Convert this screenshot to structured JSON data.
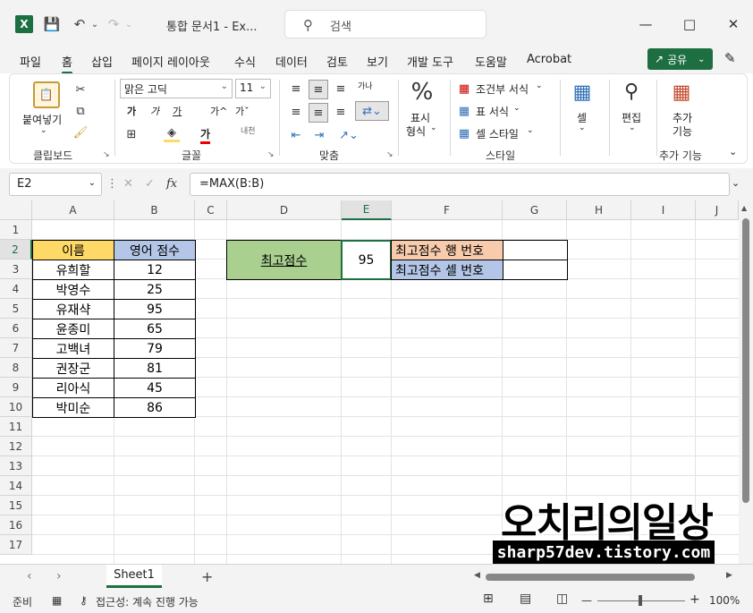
{
  "titlebar": {
    "app_icon": "X",
    "doc_title": "통합 문서1  -  Ex...",
    "search_placeholder": "검색"
  },
  "menu": {
    "tabs": [
      "파일",
      "홈",
      "삽입",
      "페이지 레이아웃",
      "수식",
      "데이터",
      "검토",
      "보기",
      "개발 도구",
      "도움말",
      "Acrobat"
    ],
    "active_tab": "홈",
    "share_label": "공유"
  },
  "ribbon": {
    "clipboard": {
      "paste_label": "붙여넣기",
      "group_label": "클립보드"
    },
    "font": {
      "font_name": "맑은 고딕",
      "font_size": "11",
      "bold_glyph": "가",
      "italic_glyph": "가",
      "underline_glyph": "가",
      "grow_glyph": "가^",
      "shrink_glyph": "가ˇ",
      "phonetic_glyph": "내천",
      "font_color_glyph": "가",
      "group_label": "글꼴"
    },
    "alignment": {
      "wrap_glyph": "가나",
      "group_label": "맞춤"
    },
    "number": {
      "label_line1": "표시",
      "label_line2": "형식",
      "group_label": ""
    },
    "styles": {
      "conditional": "조건부 서식",
      "table_format": "표 서식",
      "cell_style": "셀 스타일",
      "group_label": "스타일"
    },
    "cells": {
      "label": "셀"
    },
    "editing": {
      "label": "편집"
    },
    "addins": {
      "label_line1": "추가",
      "label_line2": "기능",
      "group_label": "추가 기능"
    }
  },
  "formula_bar": {
    "name_box": "E2",
    "fx": "fx",
    "formula": "=MAX(B:B)"
  },
  "sheet": {
    "columns": [
      "A",
      "B",
      "C",
      "D",
      "E",
      "F",
      "G",
      "H",
      "I",
      "J"
    ],
    "selected_column": "E",
    "rows": [
      "1",
      "2",
      "3",
      "4",
      "5",
      "6",
      "7",
      "8",
      "9",
      "10",
      "11",
      "12",
      "13",
      "14",
      "15",
      "16",
      "17"
    ],
    "selected_row": "2",
    "table_headers": [
      "이름",
      "영어 점수"
    ],
    "table_rows": [
      [
        "유희할",
        "12"
      ],
      [
        "박영수",
        "25"
      ],
      [
        "유재샥",
        "95"
      ],
      [
        "윤종미",
        "65"
      ],
      [
        "고백녀",
        "79"
      ],
      [
        "권장군",
        "81"
      ],
      [
        "리아식",
        "45"
      ],
      [
        "박미순",
        "86"
      ]
    ],
    "max_label": "최고점수",
    "max_value": "95",
    "max_row_label": "최고점수 행 번호",
    "max_cell_label": "최고점수 셀 번호",
    "max_row_value": "",
    "max_cell_value": ""
  },
  "watermark": {
    "title": "오치리의일상",
    "url": "sharp57dev.tistory.com"
  },
  "sheet_tabs": {
    "active": "Sheet1",
    "add": "+"
  },
  "status": {
    "ready": "준비",
    "accessibility": "접근성: 계속 진행 가능",
    "zoom_minus": "—",
    "zoom_plus": "+",
    "zoom": "100%"
  }
}
